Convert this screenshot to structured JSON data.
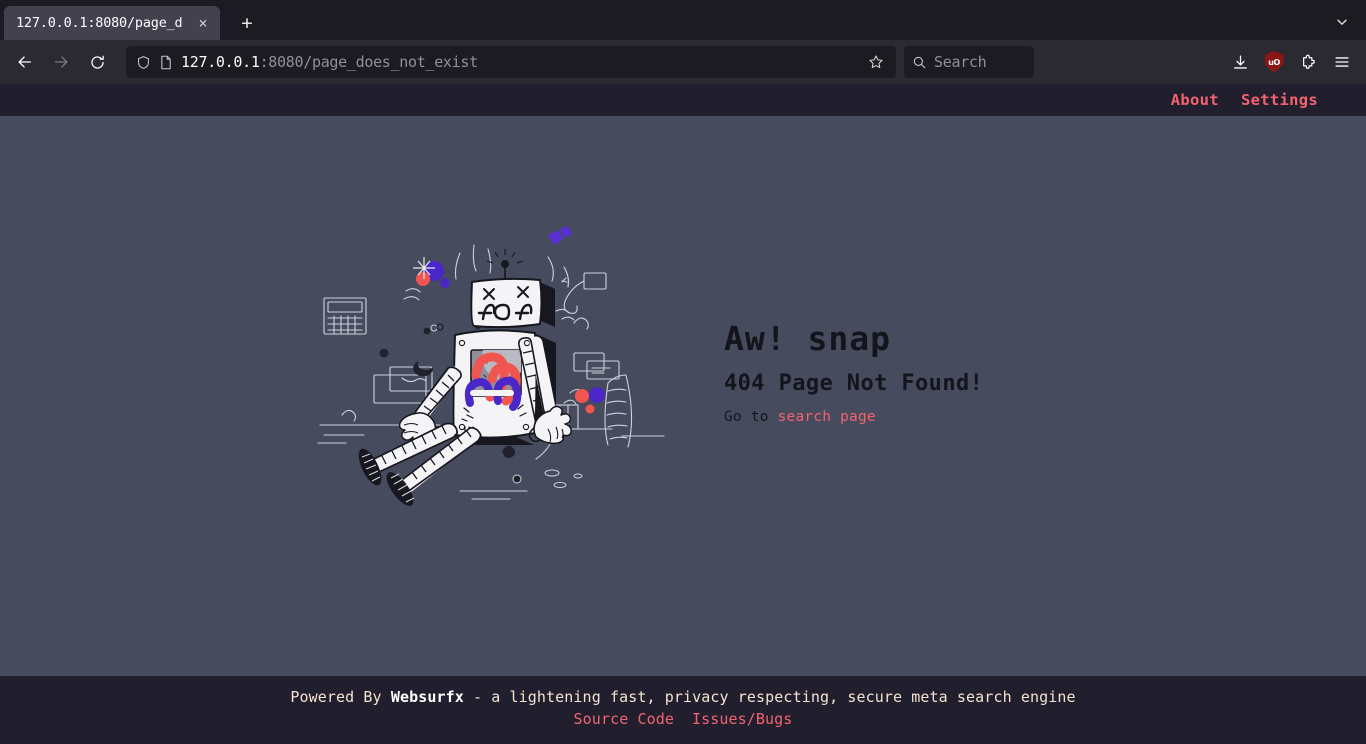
{
  "browser": {
    "tab": {
      "title": "127.0.0.1:8080/page_d",
      "close_label": "×"
    },
    "new_tab_label": "+",
    "nav": {
      "back_title": "Back",
      "forward_title": "Forward",
      "reload_title": "Reload"
    },
    "url": {
      "host": "127.0.0.1",
      "rest": ":8080/page_does_not_exist"
    },
    "search": {
      "placeholder": "Search"
    },
    "icons": {
      "shield": "shield-icon",
      "page": "page-icon",
      "star": "star-icon",
      "download": "download-icon",
      "ublock": "uO",
      "extensions": "extensions-icon",
      "menu": "hamburger-menu-icon",
      "tab_list": "chevron-down-icon"
    }
  },
  "site": {
    "header": {
      "about": "About",
      "settings": "Settings"
    },
    "error": {
      "headline": "Aw! snap",
      "subhead": "404 Page Not Found!",
      "goto_prefix": "Go to ",
      "goto_link": "search page",
      "illustration_label": "broken-robot-404-illustration",
      "robot_head_code": "404"
    },
    "footer": {
      "powered_prefix": "Powered By ",
      "brand": "Websurfx",
      "tagline": " - a lightening fast, privacy respecting, secure meta search engine",
      "source_code": "Source Code",
      "issues": "Issues/Bugs"
    }
  },
  "colors": {
    "page_bg": "#474b5e",
    "chrome_bg": "#1c1b22",
    "navbar_bg": "#2b2a33",
    "band_bg": "#211f2e",
    "accent_pink": "#f4626f",
    "footer_text": "#f3e3cf",
    "ublock_red": "#8a1616"
  }
}
